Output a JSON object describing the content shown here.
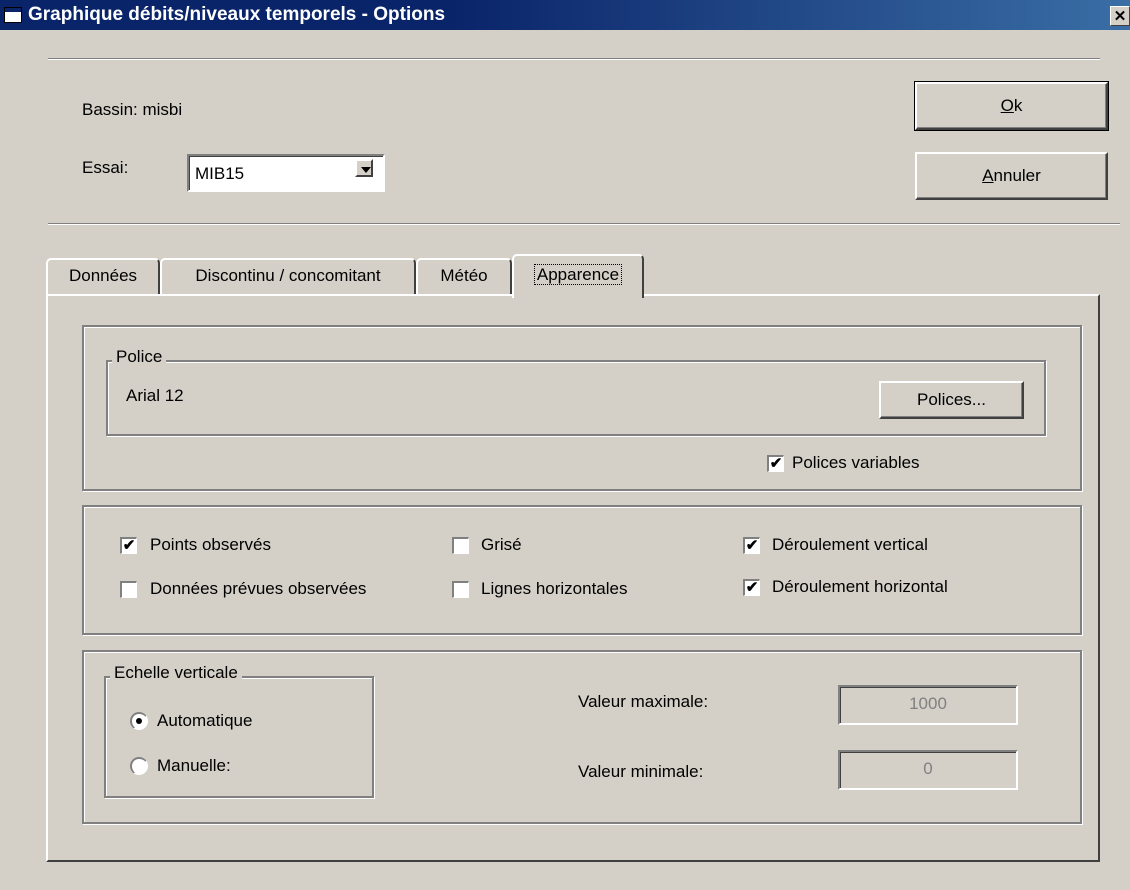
{
  "window": {
    "title": "Graphique débits/niveaux temporels - Options",
    "close_glyph": "✕"
  },
  "header": {
    "bassin_label": "Bassin: misbi",
    "essai_label": "Essai:",
    "essai_value": "MIB15"
  },
  "buttons": {
    "ok_mnemonic": "O",
    "ok_rest": "k",
    "cancel_mnemonic": "A",
    "cancel_rest": "nnuler"
  },
  "tabs": [
    {
      "label": "Données"
    },
    {
      "label": "Discontinu / concomitant"
    },
    {
      "label": "Météo"
    },
    {
      "label": "Apparence",
      "active": true
    }
  ],
  "police": {
    "group_label": "Police",
    "font_value": "Arial 12",
    "fonts_button": "Polices...",
    "variable_label": "Polices variables",
    "variable_checked": true
  },
  "options": [
    {
      "label": "Points observés",
      "checked": true
    },
    {
      "label": "Données prévues observées",
      "checked": false
    },
    {
      "label": "Grisé",
      "checked": false
    },
    {
      "label": "Lignes horizontales",
      "checked": false
    },
    {
      "label": "Déroulement vertical",
      "checked": true
    },
    {
      "label": "Déroulement horizontal",
      "checked": true
    }
  ],
  "scale": {
    "group_label": "Echelle verticale",
    "auto_label": "Automatique",
    "manual_label": "Manuelle:",
    "selected": "Automatique",
    "max_label": "Valeur maximale:",
    "max_value": "1000",
    "min_label": "Valeur minimale:",
    "min_value": "0"
  },
  "check_glyph": "✔"
}
